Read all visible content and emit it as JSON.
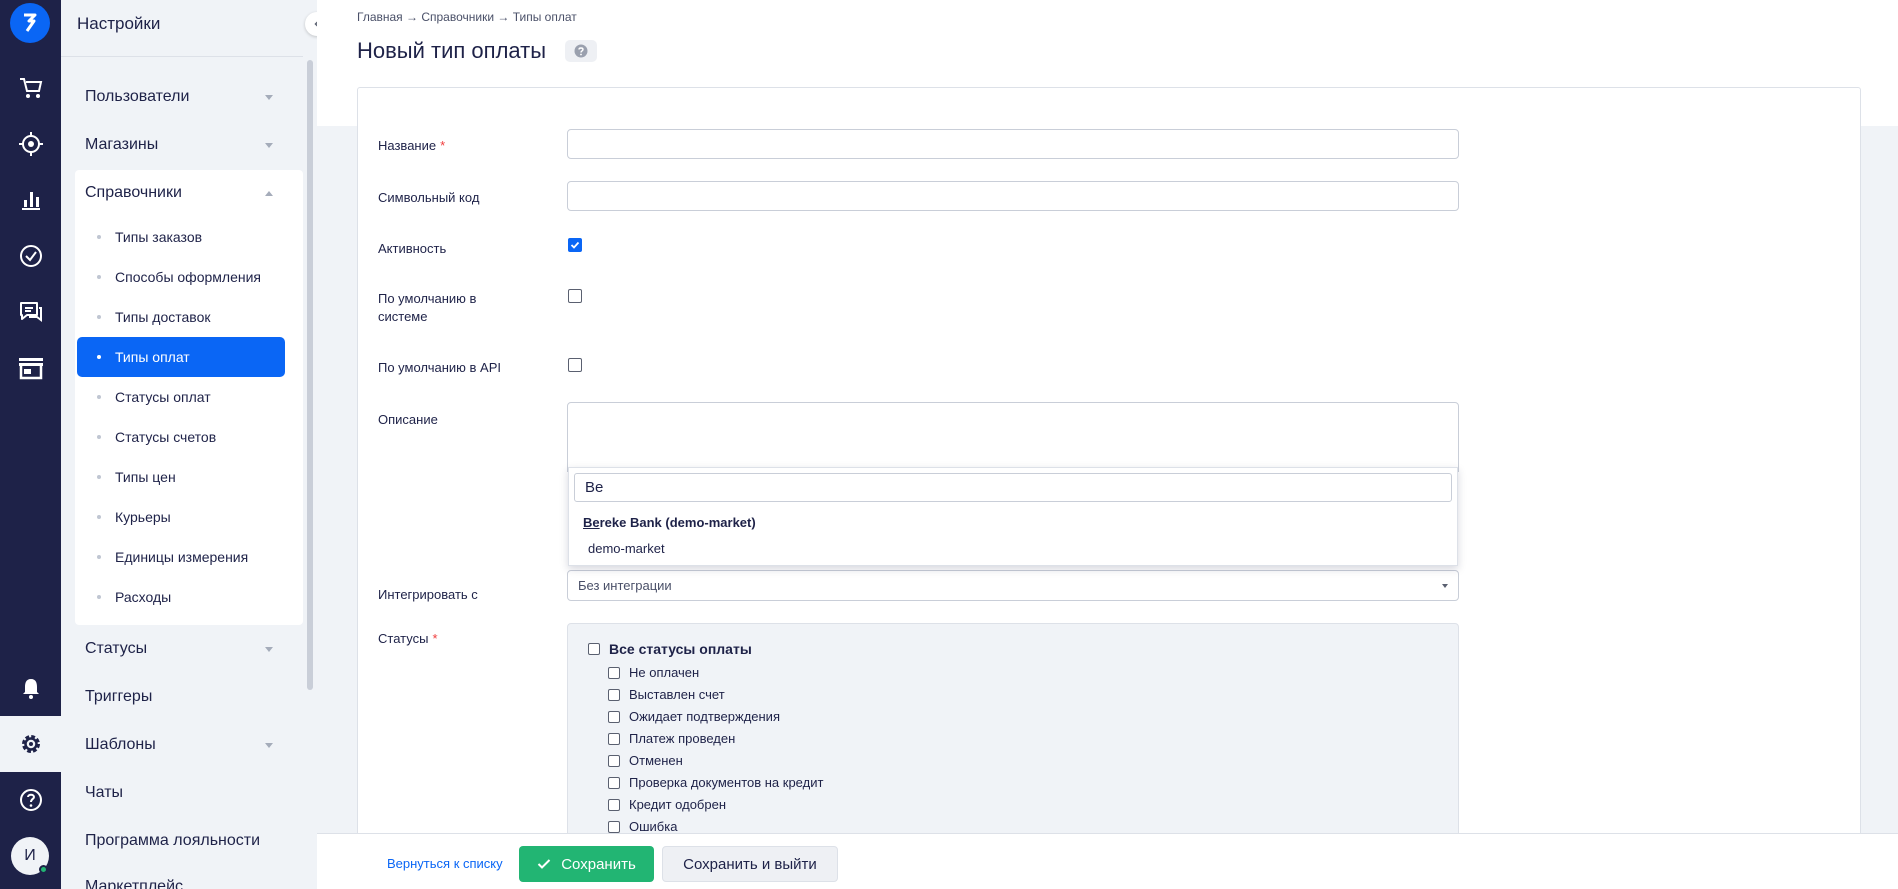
{
  "rail": {
    "icons": [
      "logo-icon",
      "cart-icon",
      "target-icon",
      "chart-icon",
      "check-circle-icon",
      "chat-icon",
      "store-icon",
      "bell-icon",
      "gear-icon",
      "help-icon"
    ],
    "avatar_letter": "И"
  },
  "sidebar": {
    "title": "Настройки",
    "sections": [
      {
        "label": "Пользователи",
        "caret": "down"
      },
      {
        "label": "Магазины",
        "caret": "down"
      },
      {
        "label": "Справочники",
        "caret": "up"
      },
      {
        "label": "Статусы",
        "caret": "down"
      },
      {
        "label": "Триггеры",
        "caret": ""
      },
      {
        "label": "Шаблоны",
        "caret": "down"
      },
      {
        "label": "Чаты",
        "caret": ""
      },
      {
        "label": "Программа лояльности",
        "caret": ""
      },
      {
        "label": "Маркетплейс",
        "caret": ""
      }
    ],
    "items": [
      {
        "label": "Типы заказов"
      },
      {
        "label": "Способы оформления"
      },
      {
        "label": "Типы доставок"
      },
      {
        "label": "Типы оплат",
        "active": true
      },
      {
        "label": "Статусы оплат"
      },
      {
        "label": "Статусы счетов"
      },
      {
        "label": "Типы цен"
      },
      {
        "label": "Курьеры"
      },
      {
        "label": "Единицы измерения"
      },
      {
        "label": "Расходы"
      }
    ]
  },
  "breadcrumb": "Главная → Справочники → Типы оплат",
  "page_title": "Новый тип оплаты",
  "form": {
    "name_label": "Название",
    "code_label": "Символьный код",
    "active_label": "Активность",
    "default_system_label_1": "По умолчанию в",
    "default_system_label_2": "системе",
    "default_api_label": "По умолчанию в API",
    "description_label": "Описание",
    "integrate_label": "Интегрировать с",
    "integrate_value": "Без интеграции",
    "statuses_label": "Статусы",
    "active_checked": true,
    "default_system_checked": false,
    "default_api_checked": false
  },
  "dropdown": {
    "search_value": "Be",
    "group_match": "Be",
    "group_rest": "reke Bank (demo-market)",
    "option": "demo-market"
  },
  "statuses": {
    "all_label": "Все статусы оплаты",
    "items": [
      "Не оплачен",
      "Выставлен счет",
      "Ожидает подтверждения",
      "Платеж проведен",
      "Отменен",
      "Проверка документов на кредит",
      "Кредит одобрен",
      "Ошибка"
    ]
  },
  "footer": {
    "back_label": "Вернуться к списку",
    "save_label": "Сохранить",
    "save_exit_label": "Сохранить и выйти"
  },
  "colors": {
    "rail": "#1e2248",
    "accent": "#0a66f5",
    "save": "#22b573",
    "required": "#f03c3c"
  }
}
